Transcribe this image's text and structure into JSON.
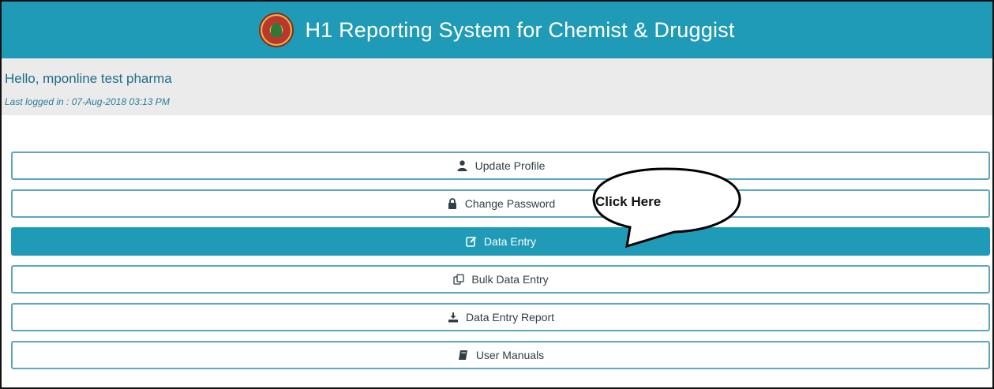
{
  "header": {
    "title": "H1 Reporting System for Chemist & Druggist",
    "logo_icon": "emblem-logo-icon"
  },
  "user": {
    "greeting": "Hello, mponline test pharma",
    "last_login": "Last logged in : 07-Aug-2018 03:13 PM"
  },
  "menu": {
    "items": [
      {
        "label": "Update Profile",
        "icon": "user-icon"
      },
      {
        "label": "Change Password",
        "icon": "lock-icon"
      },
      {
        "label": "Data Entry",
        "icon": "edit-icon",
        "active": true
      },
      {
        "label": "Bulk Data Entry",
        "icon": "copy-icon"
      },
      {
        "label": "Data Entry Report",
        "icon": "download-icon"
      },
      {
        "label": "User Manuals",
        "icon": "book-icon"
      }
    ]
  },
  "annotation": {
    "callout_text": "Click Here"
  },
  "colors": {
    "accent": "#1f9bb7",
    "userbar_bg": "#ebebeb",
    "border": "#5aa7bf"
  }
}
